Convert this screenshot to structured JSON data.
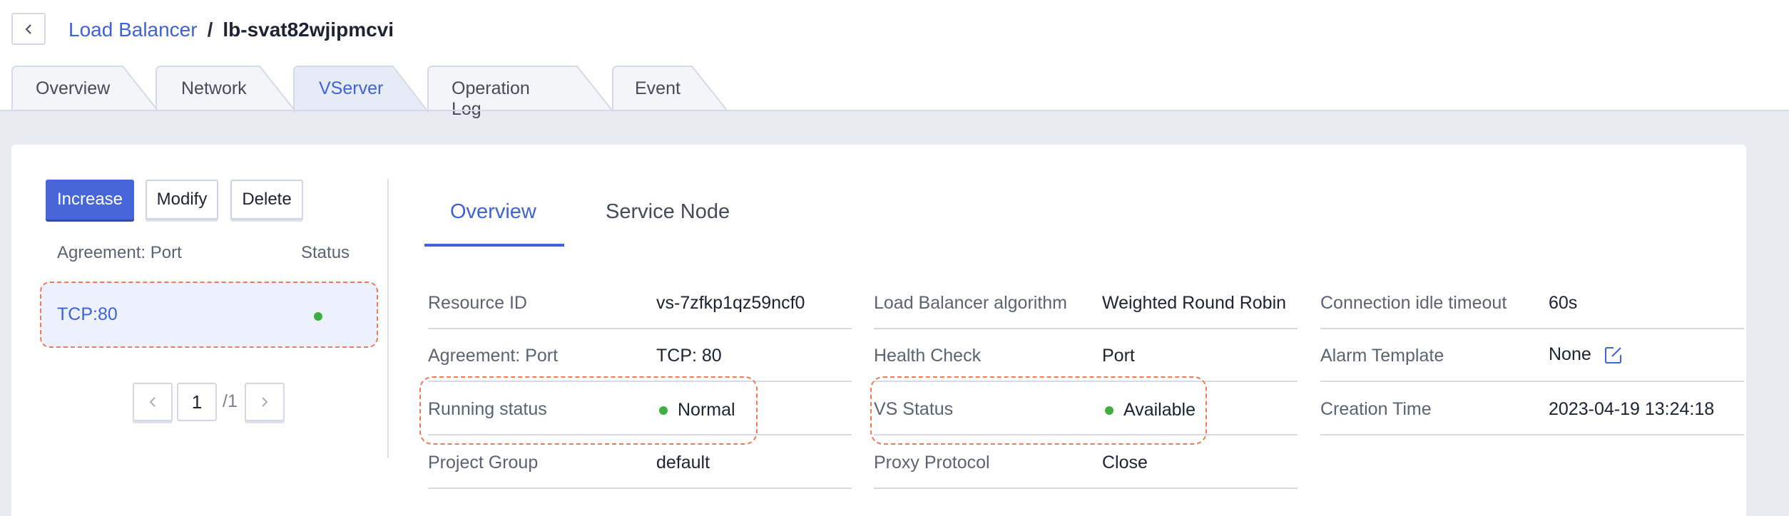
{
  "breadcrumb": {
    "parent": "Load Balancer",
    "separator": "/",
    "current": "lb-svat82wjipmcvi"
  },
  "tabs": [
    {
      "label": "Overview"
    },
    {
      "label": "Network"
    },
    {
      "label": "VServer"
    },
    {
      "label": "Operation Log"
    },
    {
      "label": "Event"
    }
  ],
  "active_tab": "VServer",
  "toolbar": {
    "increase_label": "Increase",
    "modify_label": "Modify",
    "delete_label": "Delete"
  },
  "list": {
    "header_port": "Agreement: Port",
    "header_status": "Status",
    "items": [
      {
        "port": "TCP:80",
        "status": "green"
      }
    ]
  },
  "pagination": {
    "current_page": "1",
    "total": "/1"
  },
  "inner_tabs": [
    {
      "label": "Overview"
    },
    {
      "label": "Service Node"
    }
  ],
  "details": {
    "col1": [
      {
        "label": "Resource ID",
        "value": "vs-7zfkp1qz59ncf0"
      },
      {
        "label": "Agreement: Port",
        "value": "TCP: 80"
      },
      {
        "label": "Running status",
        "value": "Normal"
      },
      {
        "label": "Project Group",
        "value": "default"
      }
    ],
    "col2": [
      {
        "label": "Load Balancer algorithm",
        "value": "Weighted Round Robin"
      },
      {
        "label": "Health Check",
        "value": "Port"
      },
      {
        "label": "VS Status",
        "value": "Available"
      },
      {
        "label": "Proxy Protocol",
        "value": "Close"
      }
    ],
    "col3": [
      {
        "label": "Connection idle timeout",
        "value": "60s"
      },
      {
        "label": "Alarm Template",
        "value": "None"
      },
      {
        "label": "Creation Time",
        "value": "2023-04-19 13:24:18"
      }
    ]
  },
  "colors": {
    "accent": "#3f63d6",
    "primary_button": "#4767d8",
    "status_green": "#3fae3f",
    "highlight_dash": "#ef7a55"
  }
}
